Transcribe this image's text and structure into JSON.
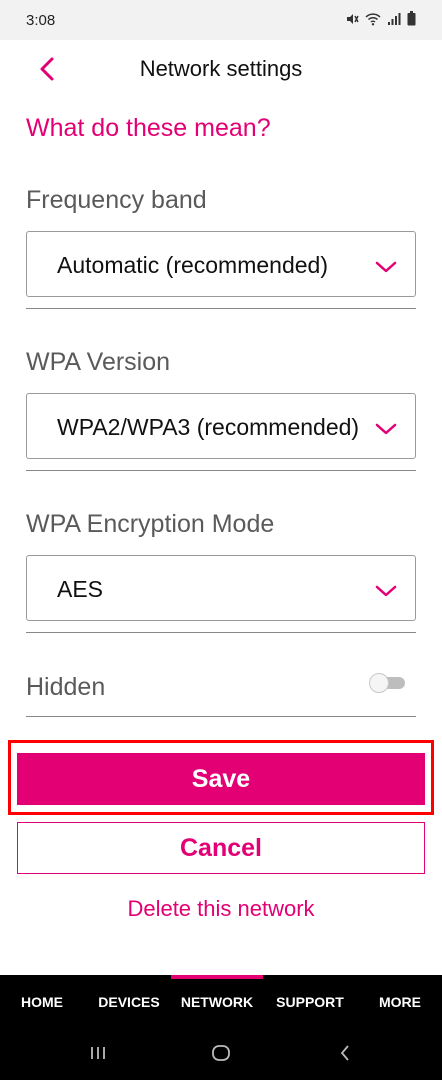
{
  "status_bar": {
    "time": "3:08",
    "icons": [
      "mute-icon",
      "wifi-icon",
      "signal-icon",
      "battery-icon"
    ]
  },
  "header": {
    "title": "Network settings",
    "back_icon": "chevron-left-icon"
  },
  "help_link": "What do these mean?",
  "fields": {
    "frequency_band": {
      "label": "Frequency band",
      "value": "Automatic (recommended)"
    },
    "wpa_version": {
      "label": "WPA Version",
      "value": "WPA2/WPA3 (recommended)"
    },
    "wpa_encryption": {
      "label": "WPA Encryption Mode",
      "value": "AES"
    },
    "hidden": {
      "label": "Hidden",
      "enabled": false
    }
  },
  "actions": {
    "save": "Save",
    "cancel": "Cancel",
    "delete": "Delete this network"
  },
  "tabs": [
    {
      "label": "HOME",
      "active": false
    },
    {
      "label": "DEVICES",
      "active": false
    },
    {
      "label": "NETWORK",
      "active": true
    },
    {
      "label": "SUPPORT",
      "active": false
    },
    {
      "label": "MORE",
      "active": false
    }
  ],
  "colors": {
    "accent": "#e20074",
    "highlight_border": "#ff0000",
    "tab_bar": "#000000"
  }
}
